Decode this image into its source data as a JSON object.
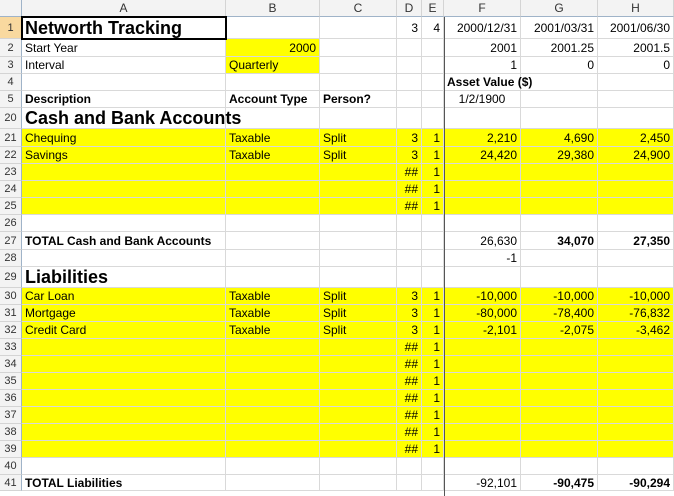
{
  "columns": [
    "A",
    "B",
    "C",
    "D",
    "E",
    "F",
    "G",
    "H"
  ],
  "rows": [
    {
      "num": "1",
      "cells": {
        "A": "Networth Tracking",
        "D": "3",
        "E": "4",
        "F": "2000/12/31",
        "G": "2001/03/31",
        "H": "2001/06/30"
      }
    },
    {
      "num": "2",
      "cells": {
        "A": "Start Year",
        "B": "2000",
        "F": "2001",
        "G": "2001.25",
        "H": "2001.5"
      }
    },
    {
      "num": "3",
      "cells": {
        "A": "Interval",
        "B": "Quarterly",
        "F": "1",
        "G": "0",
        "H": "0"
      }
    },
    {
      "num": "4",
      "cells": {
        "F": "Asset Value ($)"
      }
    },
    {
      "num": "5",
      "cells": {
        "A": "Description",
        "B": "Account Type",
        "C": "Person?",
        "F": "1/2/1900"
      }
    },
    {
      "num": "20",
      "cells": {
        "A": "Cash and Bank Accounts"
      }
    },
    {
      "num": "21",
      "cells": {
        "A": "Chequing",
        "B": "Taxable",
        "C": "Split",
        "D": "3",
        "E": "1",
        "F": "2,210",
        "G": "4,690",
        "H": "2,450"
      }
    },
    {
      "num": "22",
      "cells": {
        "A": "Savings",
        "B": "Taxable",
        "C": "Split",
        "D": "3",
        "E": "1",
        "F": "24,420",
        "G": "29,380",
        "H": "24,900"
      }
    },
    {
      "num": "23",
      "cells": {
        "D": "##",
        "E": "1"
      }
    },
    {
      "num": "24",
      "cells": {
        "D": "##",
        "E": "1"
      }
    },
    {
      "num": "25",
      "cells": {
        "D": "##",
        "E": "1"
      }
    },
    {
      "num": "26",
      "cells": {}
    },
    {
      "num": "27",
      "cells": {
        "A": "TOTAL Cash and Bank Accounts",
        "F": "26,630",
        "G": "34,070",
        "H": "27,350"
      }
    },
    {
      "num": "28",
      "cells": {
        "F": "-1"
      }
    },
    {
      "num": "29",
      "cells": {
        "A": "Liabilities"
      }
    },
    {
      "num": "30",
      "cells": {
        "A": "Car Loan",
        "B": "Taxable",
        "C": "Split",
        "D": "3",
        "E": "1",
        "F": "-10,000",
        "G": "-10,000",
        "H": "-10,000"
      }
    },
    {
      "num": "31",
      "cells": {
        "A": "Mortgage",
        "B": "Taxable",
        "C": "Split",
        "D": "3",
        "E": "1",
        "F": "-80,000",
        "G": "-78,400",
        "H": "-76,832"
      }
    },
    {
      "num": "32",
      "cells": {
        "A": "Credit Card",
        "B": "Taxable",
        "C": "Split",
        "D": "3",
        "E": "1",
        "F": "-2,101",
        "G": "-2,075",
        "H": "-3,462"
      }
    },
    {
      "num": "33",
      "cells": {
        "D": "##",
        "E": "1"
      }
    },
    {
      "num": "34",
      "cells": {
        "D": "##",
        "E": "1"
      }
    },
    {
      "num": "35",
      "cells": {
        "D": "##",
        "E": "1"
      }
    },
    {
      "num": "36",
      "cells": {
        "D": "##",
        "E": "1"
      }
    },
    {
      "num": "37",
      "cells": {
        "D": "##",
        "E": "1"
      }
    },
    {
      "num": "38",
      "cells": {
        "D": "##",
        "E": "1"
      }
    },
    {
      "num": "39",
      "cells": {
        "D": "##",
        "E": "1"
      }
    },
    {
      "num": "40",
      "cells": {}
    },
    {
      "num": "41",
      "cells": {
        "A": "TOTAL Liabilities",
        "F": "-92,101",
        "G": "-90,475",
        "H": "-90,294"
      }
    }
  ],
  "colors": {
    "highlight": "#ffff00",
    "header_bg": "#f3f3f3",
    "selected_row_header": "#f9d99f"
  }
}
